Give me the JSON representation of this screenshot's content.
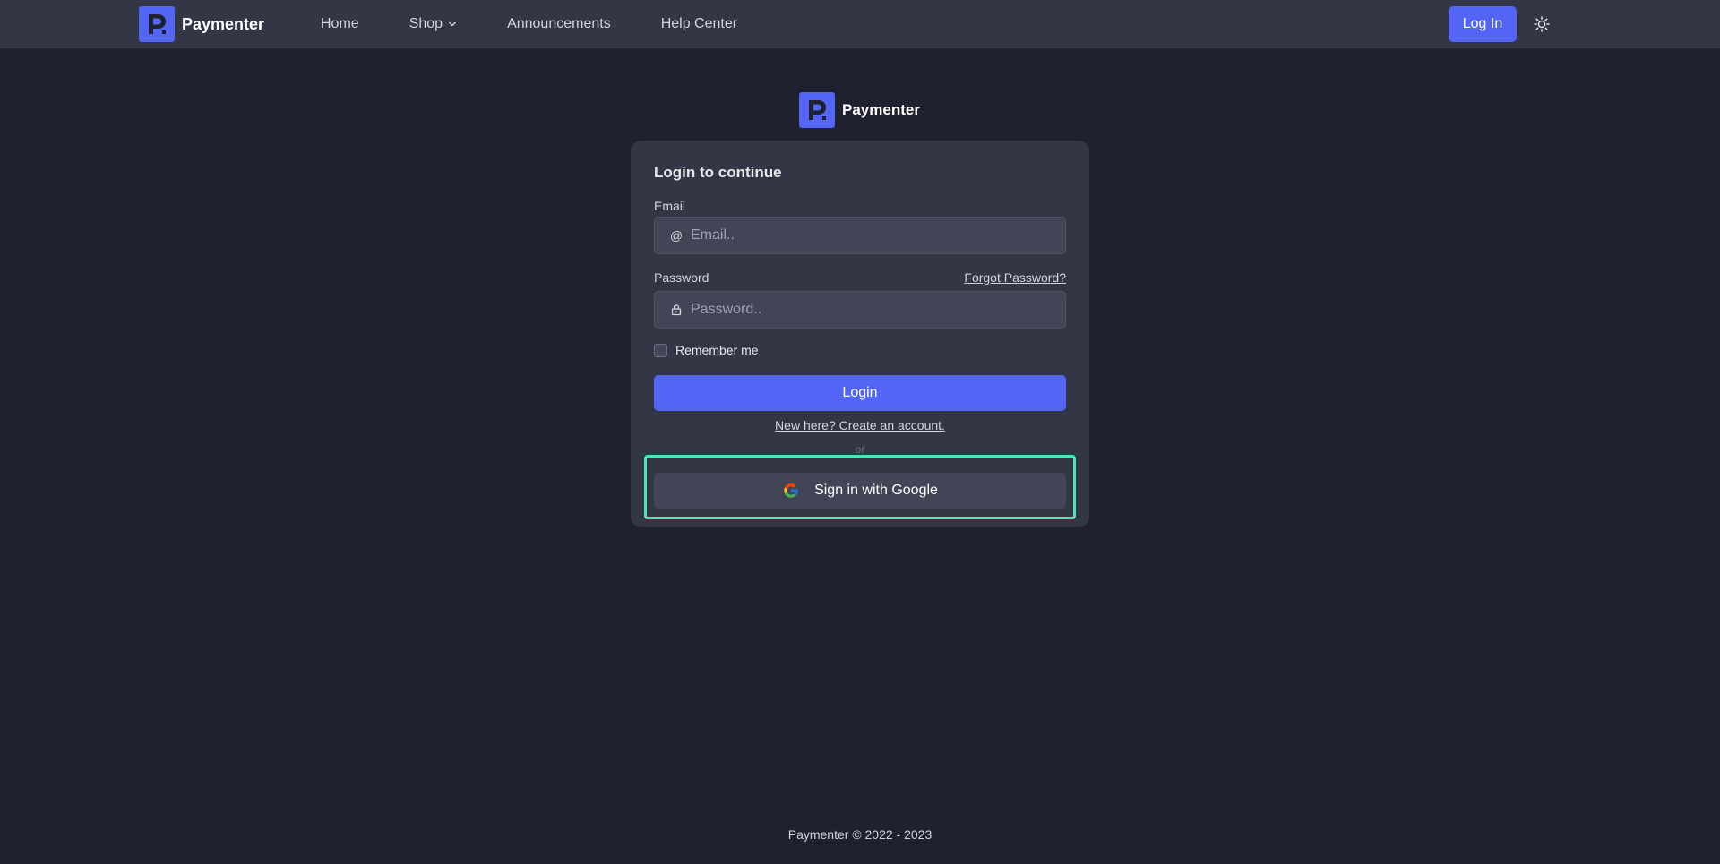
{
  "nav": {
    "brand": "Paymenter",
    "links": [
      {
        "label": "Home"
      },
      {
        "label": "Shop",
        "has_dropdown": true
      },
      {
        "label": "Announcements"
      },
      {
        "label": "Help Center"
      }
    ],
    "login_label": "Log In",
    "theme_icon": "sun-icon"
  },
  "logo": {
    "letter": "P",
    "color": "#5265f5"
  },
  "center_brand": "Paymenter",
  "form": {
    "title": "Login to continue",
    "email_label": "Email",
    "email_placeholder": "Email..",
    "password_label": "Password",
    "password_placeholder": "Password..",
    "forgot_label": "Forgot Password?",
    "remember_label": "Remember me",
    "submit_label": "Login",
    "register_label": "New here? Create an account.",
    "divider_label": "or",
    "google_label": "Sign in with Google"
  },
  "footer": {
    "text": "Paymenter © 2022 - 2023"
  },
  "colors": {
    "accent": "#5265f5",
    "highlight": "#4ee5b4",
    "background": "#1f212e",
    "card": "#333645"
  }
}
